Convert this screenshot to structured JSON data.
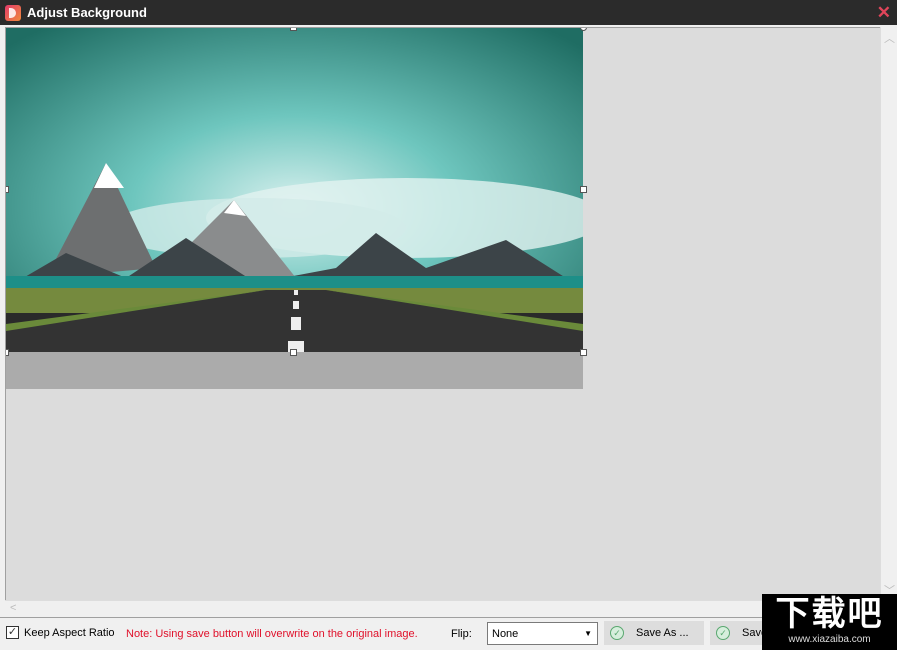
{
  "window": {
    "title": "Adjust Background",
    "close_icon": "close-x-icon",
    "app_icon": "app-logo-icon"
  },
  "footer": {
    "keep_aspect_label": "Keep Aspect Ratio",
    "keep_aspect_checked": true,
    "note": "Note: Using save button will overwrite on the original image.",
    "flip_label": "Flip:",
    "flip_value": "None",
    "save_as_label": "Save As ...",
    "save_label": "Save"
  },
  "watermark": {
    "text": "下载吧",
    "url": "www.xiazaiba.com"
  },
  "colors": {
    "note": "#e0102a",
    "titlebar": "#2b2b2b",
    "close": "#e0455a"
  }
}
